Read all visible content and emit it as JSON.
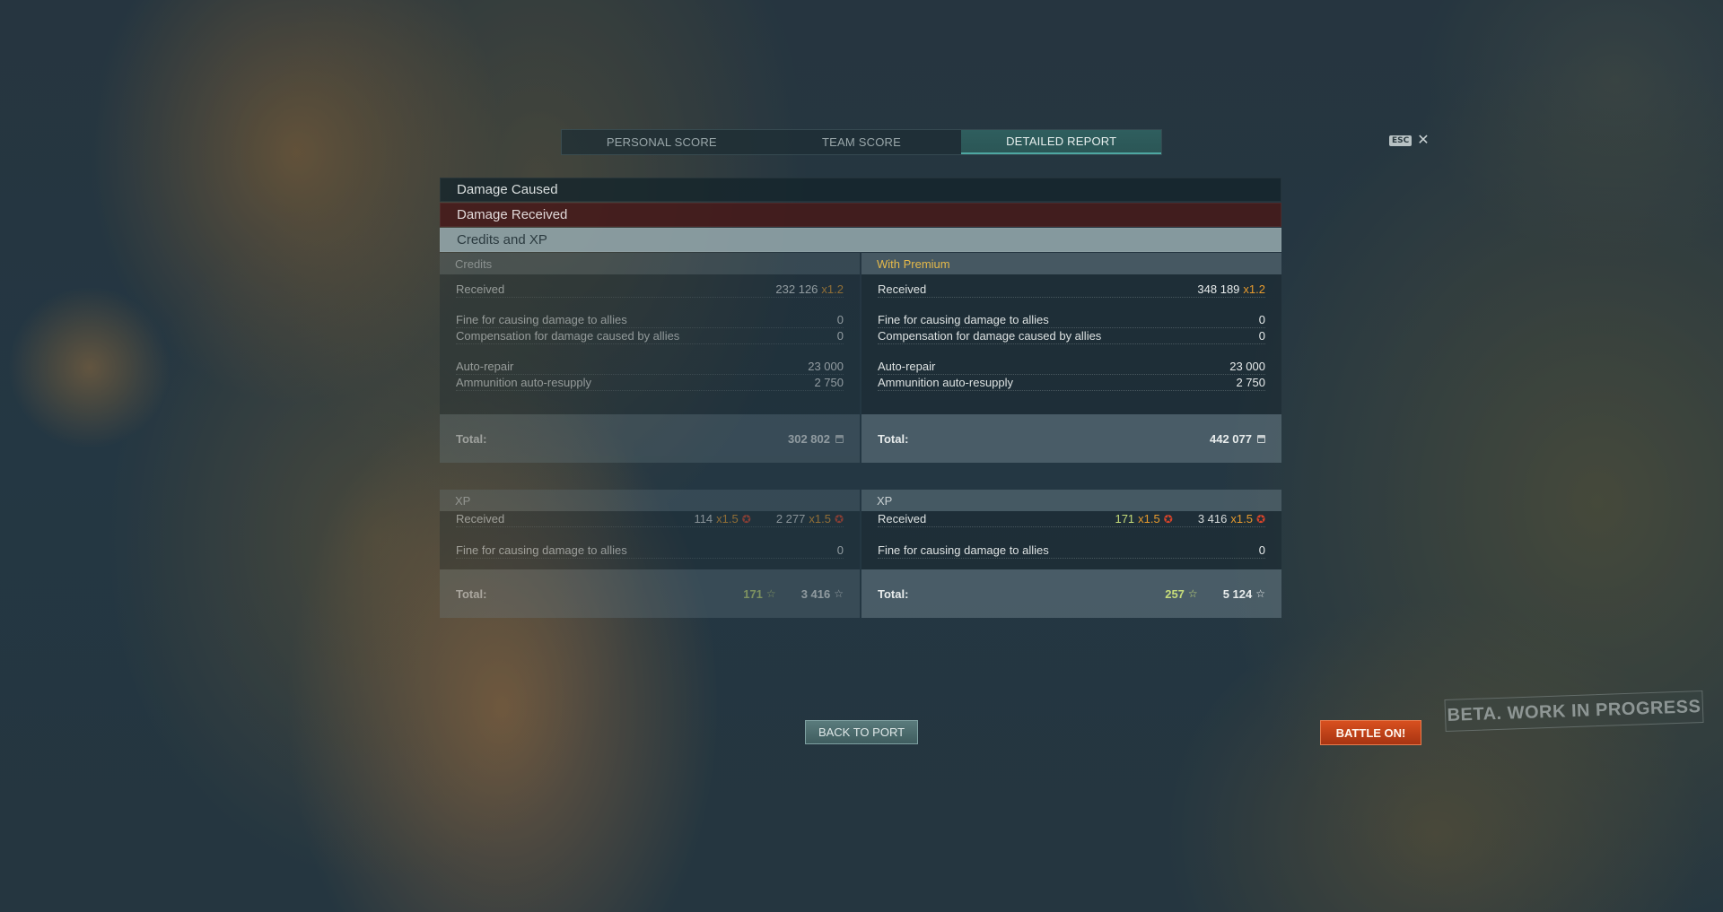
{
  "tabs": [
    {
      "label": "PERSONAL SCORE"
    },
    {
      "label": "TEAM SCORE"
    },
    {
      "label": "DETAILED REPORT"
    }
  ],
  "esc": {
    "key": "ESC",
    "close_icon": "close-icon"
  },
  "sections": {
    "damage_caused": "Damage Caused",
    "damage_received": "Damage Received",
    "credits_xp": "Credits and XP"
  },
  "credits": {
    "left": {
      "header": "Credits",
      "received_label": "Received",
      "received_value": "232 126",
      "received_mult": "x1.2",
      "fine_label": "Fine for causing damage to allies",
      "fine_value": "0",
      "comp_label": "Compensation for damage caused by allies",
      "comp_value": "0",
      "repair_label": "Auto-repair",
      "repair_value": "23 000",
      "ammo_label": "Ammunition auto-resupply",
      "ammo_value": "2 750",
      "total_label": "Total:",
      "total_value": "302 802"
    },
    "right": {
      "header": "With Premium",
      "received_label": "Received",
      "received_value": "348 189",
      "received_mult": "x1.2",
      "fine_label": "Fine for causing damage to allies",
      "fine_value": "0",
      "comp_label": "Compensation for damage caused by allies",
      "comp_value": "0",
      "repair_label": "Auto-repair",
      "repair_value": "23 000",
      "ammo_label": "Ammunition auto-resupply",
      "ammo_value": "2 750",
      "total_label": "Total:",
      "total_value": "442 077"
    }
  },
  "xp": {
    "left": {
      "header": "XP",
      "received_label": "Received",
      "received_a": "114",
      "received_a_mult": "x1.5",
      "received_b": "2 277",
      "received_b_mult": "x1.5",
      "fine_label": "Fine for causing damage to allies",
      "fine_value": "0",
      "total_label": "Total:",
      "total_a": "171",
      "total_b": "3 416"
    },
    "right": {
      "header": "XP",
      "received_label": "Received",
      "received_a": "171",
      "received_a_mult": "x1.5",
      "received_b": "3 416",
      "received_b_mult": "x1.5",
      "fine_label": "Fine for causing damage to allies",
      "fine_value": "0",
      "total_label": "Total:",
      "total_a": "257",
      "total_b": "5 124"
    }
  },
  "buttons": {
    "back_to_port": "BACK TO PORT",
    "battle_on": "BATTLE ON!"
  },
  "beta_stamp": "BETA. WORK IN PROGRESS",
  "colors": {
    "accent": "#4ea7a1",
    "premium": "#e5b94a",
    "multiplier": "#e69a2e",
    "battle": "#d8501f"
  }
}
